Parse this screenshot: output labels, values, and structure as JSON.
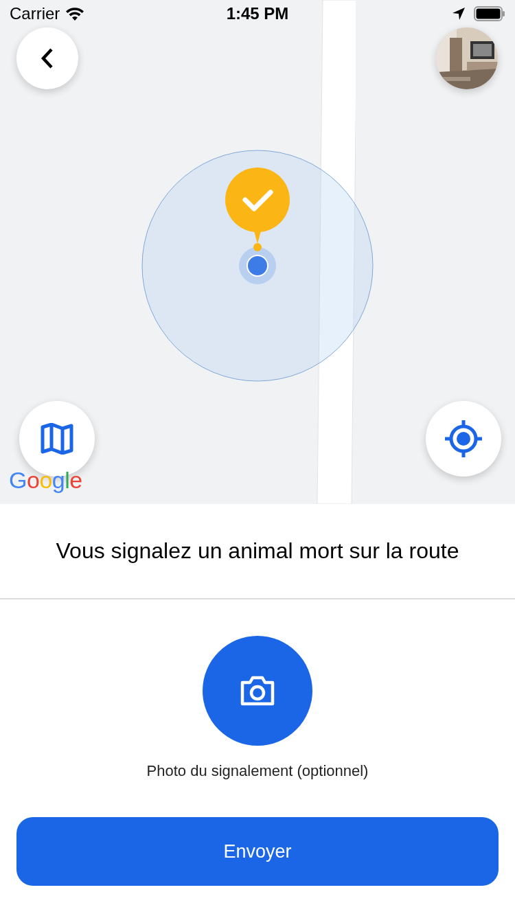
{
  "status_bar": {
    "carrier": "Carrier",
    "time": "1:45 PM"
  },
  "map": {
    "logo": "Google"
  },
  "title": "Vous signalez un animal mort sur la route",
  "photo_caption": "Photo du signalement (optionnel)",
  "submit_button": "Envoyer"
}
